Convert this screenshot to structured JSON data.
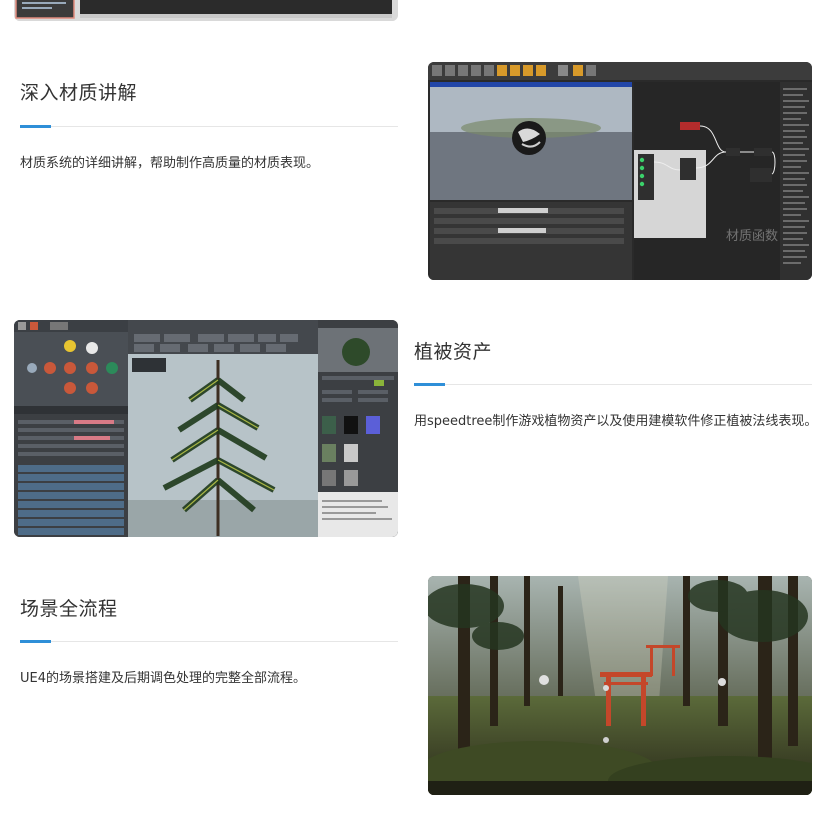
{
  "sections": [
    {
      "title": "深入材质讲解",
      "description": "材质系统的详细讲解，帮助制作高质量的材质表现。",
      "image_caption": "材质函数"
    },
    {
      "title": "植被资产",
      "description": "用speedtree制作游戏植物资产以及使用建模软件修正植被法线表现。"
    },
    {
      "title": "场景全流程",
      "description": "UE4的场景搭建及后期调色处理的完整全部流程。"
    }
  ],
  "colors": {
    "accent": "#2f8fd8",
    "text": "#333333",
    "divider": "#e6e6e6"
  }
}
